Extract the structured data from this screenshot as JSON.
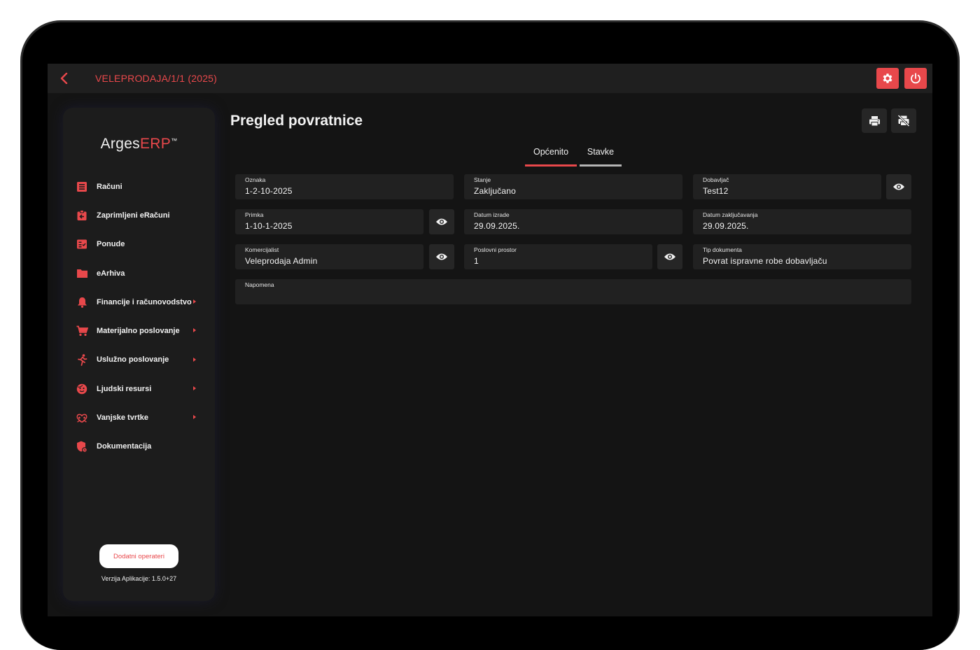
{
  "topbar": {
    "document_title": "VELEPRODAJA/1/1 (2025)"
  },
  "icons": {
    "back": "chevron-left-icon",
    "settings": "gear-icon",
    "logout": "power-icon",
    "print": "printer-icon",
    "print_off": "print-disabled-icon",
    "view": "eye-icon"
  },
  "colors": {
    "accent": "#e8484b",
    "background": "#141414",
    "panel": "#1c1c1c",
    "field": "#212121"
  },
  "sidebar": {
    "logo_main": "Arges",
    "logo_accent": "ERP",
    "logo_tm": "™",
    "items": [
      {
        "label": "Računi",
        "icon": "receipt-icon",
        "has_submenu": false
      },
      {
        "label": "Zaprimljeni eRačuni",
        "icon": "inbox-doc-icon",
        "has_submenu": false
      },
      {
        "label": "Ponude",
        "icon": "checklist-icon",
        "has_submenu": false
      },
      {
        "label": "eArhiva",
        "icon": "folder-icon",
        "has_submenu": false
      },
      {
        "label": "Financije i računovodstvo",
        "icon": "bell-icon",
        "has_submenu": true
      },
      {
        "label": "Materijalno poslovanje",
        "icon": "cart-icon",
        "has_submenu": true
      },
      {
        "label": "Uslužno poslovanje",
        "icon": "running-person-icon",
        "has_submenu": true
      },
      {
        "label": "Ljudski resursi",
        "icon": "face-icon",
        "has_submenu": true
      },
      {
        "label": "Vanjske tvrtke",
        "icon": "handshake-icon",
        "has_submenu": true
      },
      {
        "label": "Dokumentacija",
        "icon": "shield-doc-icon",
        "has_submenu": false
      }
    ],
    "extra_operators_label": "Dodatni operateri",
    "version_label": "Verzija Aplikacije: 1.5.0+27"
  },
  "main": {
    "title": "Pregled povratnice",
    "tabs": [
      {
        "label": "Općenito",
        "active": true
      },
      {
        "label": "Stavke",
        "active": false
      }
    ],
    "fields": {
      "oznaka": {
        "label": "Oznaka",
        "value": "1-2-10-2025"
      },
      "stanje": {
        "label": "Stanje",
        "value": "Zaključano"
      },
      "dobavljac": {
        "label": "Dobavljač",
        "value": "Test12"
      },
      "primka": {
        "label": "Primka",
        "value": "1-10-1-2025"
      },
      "datum_izrade": {
        "label": "Datum izrade",
        "value": "29.09.2025."
      },
      "datum_zakljucavanja": {
        "label": "Datum zaključavanja",
        "value": "29.09.2025."
      },
      "komercijalist": {
        "label": "Komercijalist",
        "value": "Veleprodaja Admin"
      },
      "poslovni_prostor": {
        "label": "Poslovni prostor",
        "value": "1"
      },
      "tip_dokumenta": {
        "label": "Tip dokumenta",
        "value": "Povrat ispravne robe dobavljaču"
      },
      "napomena": {
        "label": "Napomena",
        "value": ""
      }
    }
  }
}
